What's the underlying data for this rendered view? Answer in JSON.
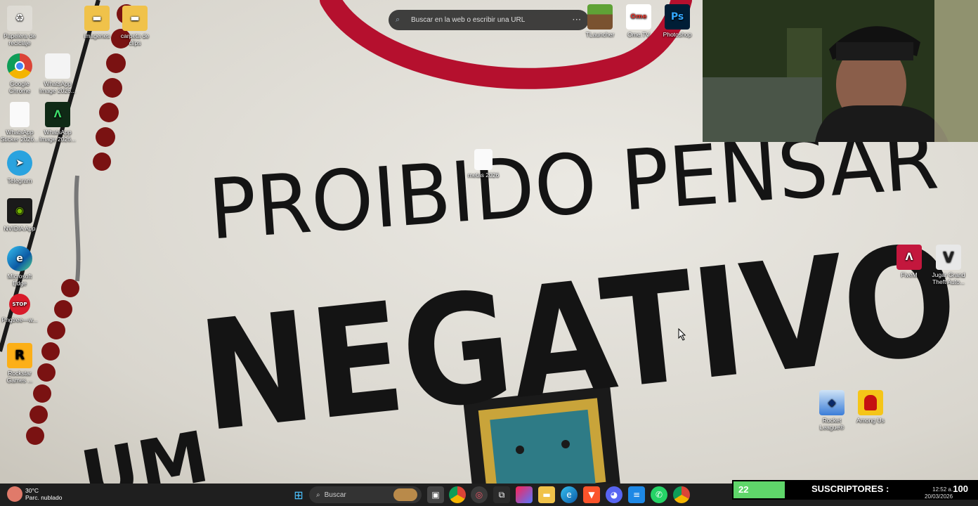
{
  "wallpaper": {
    "line1": "PROIBIDO PENSAR",
    "line2": "NEGATIVO",
    "bottom_left": "UM"
  },
  "browser_search": {
    "placeholder": "Buscar en la web o escribir una URL",
    "menu": "···"
  },
  "desktop_icons": [
    {
      "label": "Papelera de reciclaje",
      "icon": "recycle-bin-icon"
    },
    {
      "label": "imagenes",
      "icon": "folder-icon"
    },
    {
      "label": "carpeta de clips",
      "icon": "folder-icon"
    },
    {
      "label": "Google Chrome",
      "icon": "chrome-icon"
    },
    {
      "label": "WhatsApp Image 2026...",
      "icon": "image-file-icon"
    },
    {
      "label": "WhatsApp Sticker 2026...",
      "icon": "file-icon"
    },
    {
      "label": "WhatsApp Image 2026...",
      "icon": "image-file-icon"
    },
    {
      "label": "Telegram",
      "icon": "telegram-icon"
    },
    {
      "label": "NVIDIA App",
      "icon": "nvidia-icon"
    },
    {
      "label": "Microsoft Edge",
      "icon": "edge-icon"
    },
    {
      "label": "Pngtree—w...",
      "icon": "stop-sign-icon"
    },
    {
      "label": "Rockstar Games ...",
      "icon": "rockstar-icon"
    },
    {
      "label": "metas 2026",
      "icon": "file-icon"
    },
    {
      "label": "TLauncher",
      "icon": "minecraft-icon"
    },
    {
      "label": "Ome.TV",
      "icon": "ometv-icon"
    },
    {
      "label": "Photoshop",
      "icon": "photoshop-icon"
    },
    {
      "label": "FiveM",
      "icon": "fivem-icon"
    },
    {
      "label": "Jugar Grand Theft Auto...",
      "icon": "gta-icon"
    },
    {
      "label": "Rocket League®",
      "icon": "rocket-league-icon"
    },
    {
      "label": "Among Us",
      "icon": "among-us-icon"
    }
  ],
  "taskbar": {
    "weather_temp": "30°C",
    "weather_desc": "Parc. nublado",
    "search_label": "Buscar",
    "clock_time": "12:52 a.",
    "clock_date": "20/03/2026"
  },
  "subscriber_overlay": {
    "count": "22",
    "label": "SUSCRIPTORES :",
    "goal": "100"
  },
  "colors": {
    "taskbar": "#1f1f1f",
    "sub_green": "#5fd66a",
    "wallpaper_bg": "#dedbd3"
  }
}
